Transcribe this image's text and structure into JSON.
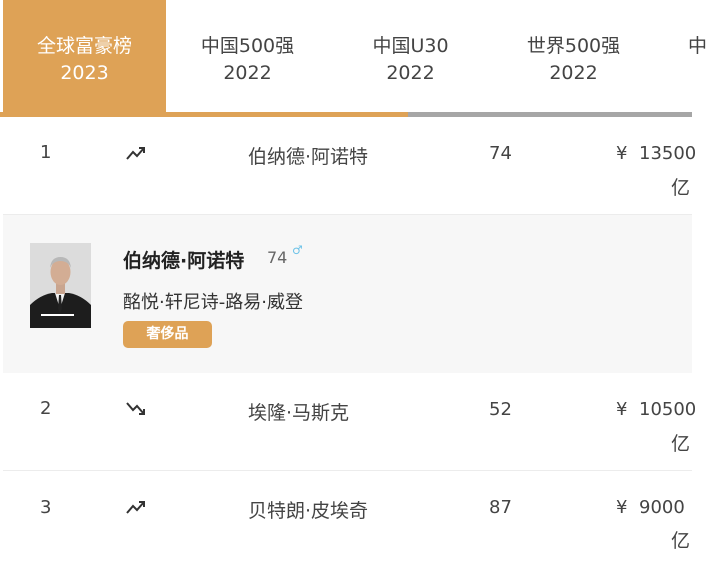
{
  "tabs": [
    {
      "title": "全球富豪榜",
      "year": "2023",
      "active": true
    },
    {
      "title": "中国500强",
      "year": "2022",
      "active": false
    },
    {
      "title": "中国U30",
      "year": "2022",
      "active": false
    },
    {
      "title": "世界500强",
      "year": "2022",
      "active": false
    },
    {
      "title": "中",
      "year": "",
      "active": false
    }
  ],
  "scroll_progress_percent": 59,
  "colors": {
    "accent": "#dea256",
    "track": "#a6a6a6",
    "gender_male": "#6ec3e8"
  },
  "rows": [
    {
      "rank": "1",
      "trend": "trend-up-icon",
      "name": "伯纳德·阿诺特",
      "age": "74",
      "currency": "¥",
      "worth": "13500",
      "unit": "亿"
    },
    {
      "rank": "2",
      "trend": "trend-down-icon",
      "name": "埃隆·马斯克",
      "age": "52",
      "currency": "¥",
      "worth": "10500",
      "unit": "亿"
    },
    {
      "rank": "3",
      "trend": "trend-up-icon",
      "name": "贝特朗·皮埃奇",
      "age": "87",
      "currency": "¥",
      "worth": "9000",
      "unit": "亿"
    }
  ],
  "detail": {
    "name": "伯纳德·阿诺特",
    "age": "74",
    "gender_icon": "male-icon",
    "gender_symbol": "♂",
    "company": "酩悦·轩尼诗-路易·威登",
    "tag": "奢侈品"
  }
}
